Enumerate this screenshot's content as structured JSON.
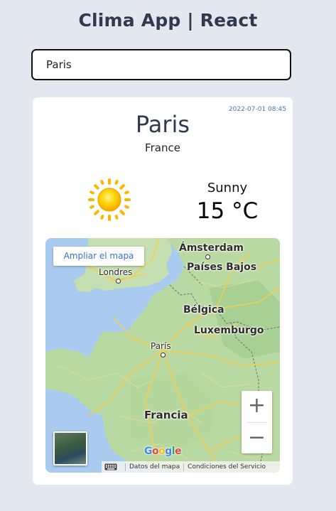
{
  "app": {
    "title": "Clima App | React"
  },
  "search": {
    "value": "Paris"
  },
  "weather": {
    "timestamp": "2022-07-01 08:45",
    "city": "Paris",
    "country": "France",
    "condition": "Sunny",
    "temperature": "15 °C",
    "icon": "sun-icon"
  },
  "map": {
    "enlarge_label": "Ampliar el mapa",
    "labels": {
      "amsterdam": "Ámsterdam",
      "paises_bajos": "Países Bajos",
      "londres": "Londres",
      "belgica": "Bélgica",
      "luxemburgo": "Luxemburgo",
      "paris": "París",
      "francia": "Francia"
    },
    "zoom_in": "+",
    "zoom_out": "−",
    "logo": "Google",
    "attribution": {
      "map_data": "Datos del mapa",
      "terms": "Condiciones del Servicio"
    }
  }
}
